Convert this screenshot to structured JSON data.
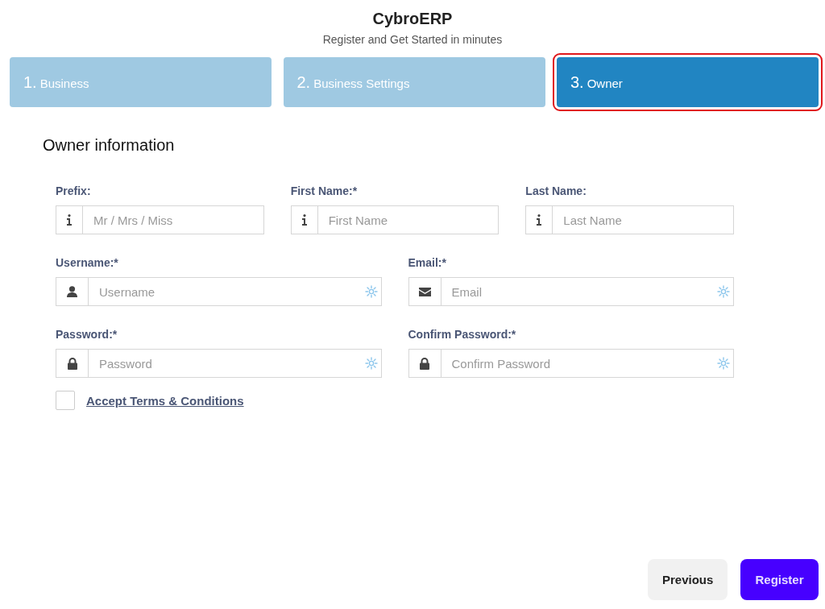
{
  "header": {
    "title": "CybroERP",
    "subtitle": "Register and Get Started in minutes"
  },
  "steps": [
    {
      "number": "1.",
      "label": "Business",
      "selected": false
    },
    {
      "number": "2.",
      "label": "Business Settings",
      "selected": false
    },
    {
      "number": "3.",
      "label": "Owner",
      "selected": true
    }
  ],
  "section_title": "Owner information",
  "field_rows": [
    [
      {
        "label": "Prefix:",
        "kind": "info",
        "placeholder": "Mr / Mrs / Miss",
        "loading": false
      },
      {
        "label": "First Name:*",
        "kind": "info",
        "placeholder": "First Name",
        "loading": false
      },
      {
        "label": "Last Name:",
        "kind": "info",
        "placeholder": "Last Name",
        "loading": false
      }
    ],
    [
      {
        "label": "Username:*",
        "kind": "user",
        "placeholder": "Username",
        "loading": true
      },
      {
        "label": "Email:*",
        "kind": "email",
        "placeholder": "Email",
        "loading": true
      }
    ],
    [
      {
        "label": "Password:*",
        "kind": "password",
        "placeholder": "Password",
        "loading": true
      },
      {
        "label": "Confirm Password:*",
        "kind": "password",
        "placeholder": "Confirm Password",
        "loading": true
      }
    ]
  ],
  "terms": {
    "label": "Accept Terms & Conditions",
    "checked": false
  },
  "buttons": [
    {
      "label": "Previous",
      "kind": "secondary"
    },
    {
      "label": "Register",
      "kind": "primary"
    }
  ]
}
